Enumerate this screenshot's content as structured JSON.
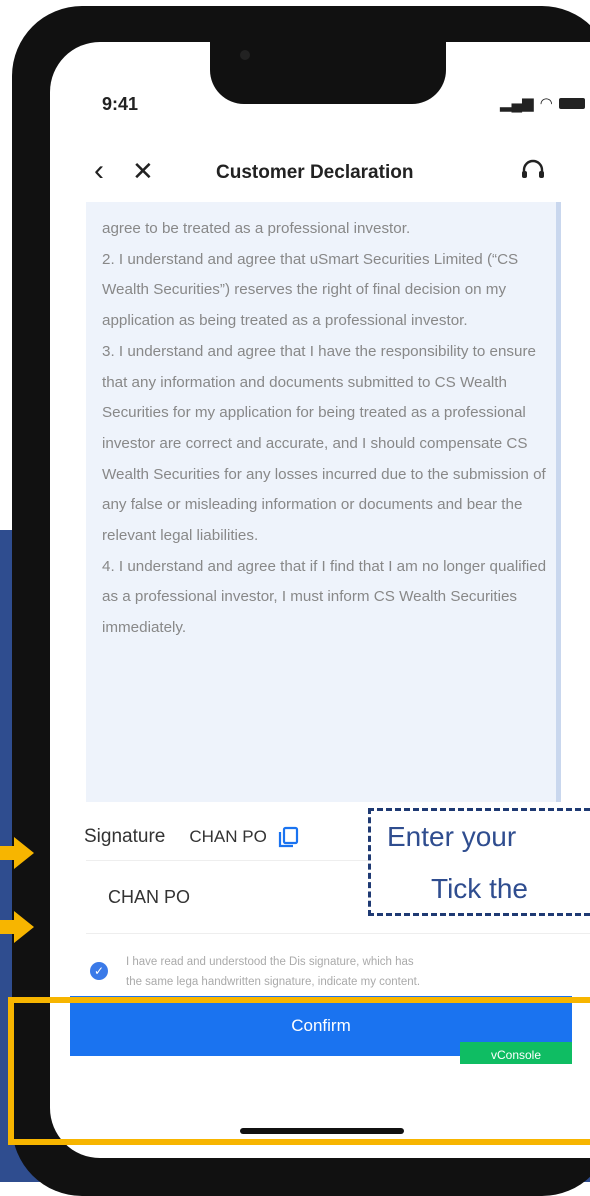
{
  "status": {
    "time": "9:41"
  },
  "nav": {
    "title": "Customer Declaration"
  },
  "declaration": {
    "paragraphs": [
      "agree to be treated as a professional investor.",
      "2. I understand and agree that uSmart Securities Limited (“CS Wealth Securities”) reserves the right of final decision on my application as being treated as a professional investor.",
      "3. I understand and agree that I have the responsibility to ensure that any information and documents submitted to CS Wealth Securities for my application for being treated as a professional investor are correct and accurate, and I should compensate CS Wealth Securities for any losses incurred due to the submission of any false or misleading information or documents and bear the relevant legal liabilities.",
      "4. I understand and agree that if I find that I am no longer qualified as a professional investor, I must inform CS Wealth Securities immediately."
    ]
  },
  "signature": {
    "label": "Signature",
    "name": "CHAN PO",
    "input_value": "CHAN PO"
  },
  "agreement": {
    "checked": true,
    "text": "I have read and understood the Dis signature, which has the same lega handwritten signature, indicate my content."
  },
  "confirm_label": "Confirm",
  "vconsole_label": "vConsole",
  "annotation": {
    "line1": "Enter your",
    "line2": "Tick the"
  },
  "colors": {
    "primary": "#1a73f0",
    "highlight": "#f7b500",
    "backdrop": "#2f4d8f",
    "declaration_bg": "#eef3fb"
  }
}
